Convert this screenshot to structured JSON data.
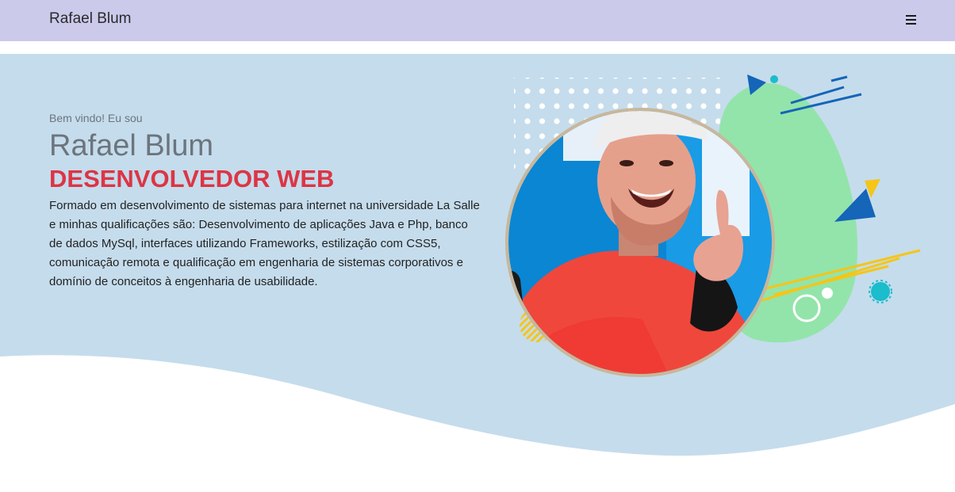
{
  "navbar": {
    "brand": "Rafael Blum",
    "menu_icon": "hamburger-menu-icon"
  },
  "hero": {
    "welcome": "Bem vindo! Eu sou",
    "name": "Rafael Blum",
    "role": "DESENVOLVEDOR WEB",
    "description": "Formado em desenvolvimento de sistemas para internet na universidade La Salle e minhas qualificações são: Desenvolvimento de aplicações Java e Php, banco de dados MySql, interfaces utilizando Frameworks, estilização com CSS5, comunicação remota e qualificação em engenharia de sistemas corporativos e domínio de conceitos à engenharia de usabilidade."
  },
  "colors": {
    "navbar_bg": "#cbcaeb",
    "hero_bg": "#c5dcec",
    "role_color": "#dc3545",
    "muted_text": "#6c757d",
    "blob_green": "#93e4aa",
    "accent_blue": "#1565b8",
    "accent_yellow": "#f5c518",
    "accent_cyan": "#1bbccc"
  }
}
